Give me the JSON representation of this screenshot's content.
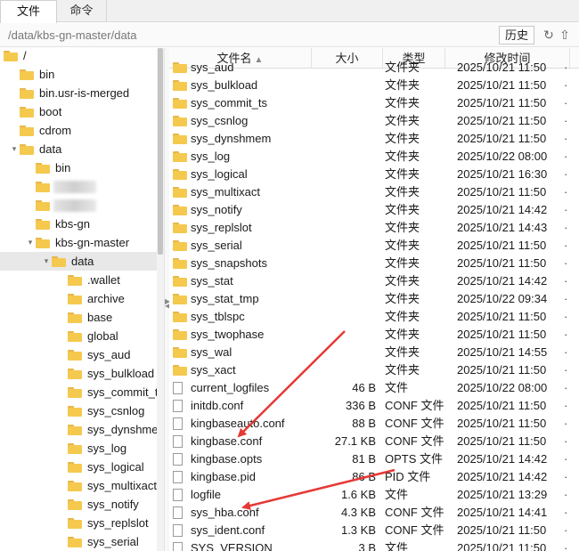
{
  "tabs": [
    {
      "label": "文件",
      "active": true
    },
    {
      "label": "命令",
      "active": false
    }
  ],
  "pathbar": {
    "path": "/data/kbs-gn-master/data",
    "history_label": "历史",
    "refresh_icon": "refresh-icon",
    "up_icon": "up-arrow-icon"
  },
  "tree": {
    "items": [
      {
        "label": "/",
        "indent": 0,
        "expanded": true
      },
      {
        "label": "bin",
        "indent": 1
      },
      {
        "label": "bin.usr-is-merged",
        "indent": 1
      },
      {
        "label": "boot",
        "indent": 1
      },
      {
        "label": "cdrom",
        "indent": 1
      },
      {
        "label": "data",
        "indent": 1,
        "expanded": true
      },
      {
        "label": "bin",
        "indent": 2
      },
      {
        "label": "",
        "indent": 2,
        "blurred": true
      },
      {
        "label": "",
        "indent": 2,
        "blurred": true
      },
      {
        "label": "kbs-gn",
        "indent": 2
      },
      {
        "label": "kbs-gn-master",
        "indent": 2,
        "expanded": true
      },
      {
        "label": "data",
        "indent": 3,
        "expanded": true,
        "selected": true
      },
      {
        "label": ".wallet",
        "indent": 4
      },
      {
        "label": "archive",
        "indent": 4
      },
      {
        "label": "base",
        "indent": 4
      },
      {
        "label": "global",
        "indent": 4
      },
      {
        "label": "sys_aud",
        "indent": 4
      },
      {
        "label": "sys_bulkload",
        "indent": 4
      },
      {
        "label": "sys_commit_ts",
        "indent": 4
      },
      {
        "label": "sys_csnlog",
        "indent": 4
      },
      {
        "label": "sys_dynshmem",
        "indent": 4
      },
      {
        "label": "sys_log",
        "indent": 4
      },
      {
        "label": "sys_logical",
        "indent": 4
      },
      {
        "label": "sys_multixact",
        "indent": 4
      },
      {
        "label": "sys_notify",
        "indent": 4
      },
      {
        "label": "sys_replslot",
        "indent": 4
      },
      {
        "label": "sys_serial",
        "indent": 4
      }
    ]
  },
  "list": {
    "columns": {
      "name": "文件名",
      "size": "大小",
      "type": "类型",
      "mtime": "修改时间"
    },
    "rows": [
      {
        "name": "sys_aud",
        "size": "",
        "type": "文件夹",
        "mtime": "2025/10/21 11:50",
        "kind": "folder",
        "partial": true
      },
      {
        "name": "sys_bulkload",
        "size": "",
        "type": "文件夹",
        "mtime": "2025/10/21 11:50",
        "kind": "folder"
      },
      {
        "name": "sys_commit_ts",
        "size": "",
        "type": "文件夹",
        "mtime": "2025/10/21 11:50",
        "kind": "folder"
      },
      {
        "name": "sys_csnlog",
        "size": "",
        "type": "文件夹",
        "mtime": "2025/10/21 11:50",
        "kind": "folder"
      },
      {
        "name": "sys_dynshmem",
        "size": "",
        "type": "文件夹",
        "mtime": "2025/10/21 11:50",
        "kind": "folder"
      },
      {
        "name": "sys_log",
        "size": "",
        "type": "文件夹",
        "mtime": "2025/10/22 08:00",
        "kind": "folder"
      },
      {
        "name": "sys_logical",
        "size": "",
        "type": "文件夹",
        "mtime": "2025/10/21 16:30",
        "kind": "folder"
      },
      {
        "name": "sys_multixact",
        "size": "",
        "type": "文件夹",
        "mtime": "2025/10/21 11:50",
        "kind": "folder"
      },
      {
        "name": "sys_notify",
        "size": "",
        "type": "文件夹",
        "mtime": "2025/10/21 14:42",
        "kind": "folder"
      },
      {
        "name": "sys_replslot",
        "size": "",
        "type": "文件夹",
        "mtime": "2025/10/21 14:43",
        "kind": "folder"
      },
      {
        "name": "sys_serial",
        "size": "",
        "type": "文件夹",
        "mtime": "2025/10/21 11:50",
        "kind": "folder"
      },
      {
        "name": "sys_snapshots",
        "size": "",
        "type": "文件夹",
        "mtime": "2025/10/21 11:50",
        "kind": "folder"
      },
      {
        "name": "sys_stat",
        "size": "",
        "type": "文件夹",
        "mtime": "2025/10/21 14:42",
        "kind": "folder"
      },
      {
        "name": "sys_stat_tmp",
        "size": "",
        "type": "文件夹",
        "mtime": "2025/10/22 09:34",
        "kind": "folder"
      },
      {
        "name": "sys_tblspc",
        "size": "",
        "type": "文件夹",
        "mtime": "2025/10/21 11:50",
        "kind": "folder"
      },
      {
        "name": "sys_twophase",
        "size": "",
        "type": "文件夹",
        "mtime": "2025/10/21 11:50",
        "kind": "folder"
      },
      {
        "name": "sys_wal",
        "size": "",
        "type": "文件夹",
        "mtime": "2025/10/21 14:55",
        "kind": "folder"
      },
      {
        "name": "sys_xact",
        "size": "",
        "type": "文件夹",
        "mtime": "2025/10/21 11:50",
        "kind": "folder"
      },
      {
        "name": "current_logfiles",
        "size": "46 B",
        "type": "文件",
        "mtime": "2025/10/22 08:00",
        "kind": "file"
      },
      {
        "name": "initdb.conf",
        "size": "336 B",
        "type": "CONF 文件",
        "mtime": "2025/10/21 11:50",
        "kind": "file"
      },
      {
        "name": "kingbaseauto.conf",
        "size": "88 B",
        "type": "CONF 文件",
        "mtime": "2025/10/21 11:50",
        "kind": "file"
      },
      {
        "name": "kingbase.conf",
        "size": "27.1 KB",
        "type": "CONF 文件",
        "mtime": "2025/10/21 11:50",
        "kind": "file"
      },
      {
        "name": "kingbase.opts",
        "size": "81 B",
        "type": "OPTS 文件",
        "mtime": "2025/10/21 14:42",
        "kind": "file"
      },
      {
        "name": "kingbase.pid",
        "size": "86 B",
        "type": "PID 文件",
        "mtime": "2025/10/21 14:42",
        "kind": "file"
      },
      {
        "name": "logfile",
        "size": "1.6 KB",
        "type": "文件",
        "mtime": "2025/10/21 13:29",
        "kind": "file"
      },
      {
        "name": "sys_hba.conf",
        "size": "4.3 KB",
        "type": "CONF 文件",
        "mtime": "2025/10/21 14:41",
        "kind": "file"
      },
      {
        "name": "sys_ident.conf",
        "size": "1.3 KB",
        "type": "CONF 文件",
        "mtime": "2025/10/21 11:50",
        "kind": "file"
      },
      {
        "name": "SYS_VERSION",
        "size": "3 B",
        "type": "文件",
        "mtime": "2025/10/21 11:50",
        "kind": "file"
      }
    ]
  },
  "annotation": {
    "arrow_color": "#e53935"
  }
}
